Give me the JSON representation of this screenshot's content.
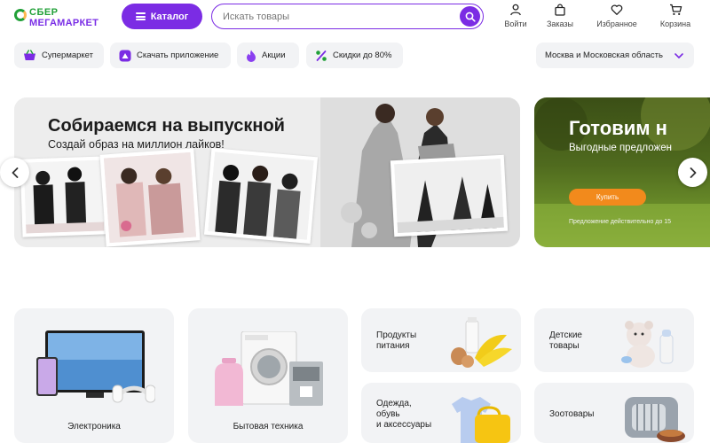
{
  "header": {
    "logo_line1": "СБЕР",
    "logo_line2": "МЕГАМАРКЕТ",
    "catalog_label": "Каталог",
    "search_placeholder": "Искать товары",
    "links": [
      {
        "label": "Войти",
        "icon": "user-icon"
      },
      {
        "label": "Заказы",
        "icon": "bag-icon"
      },
      {
        "label": "Избранное",
        "icon": "heart-icon"
      },
      {
        "label": "Корзина",
        "icon": "cart-icon"
      }
    ]
  },
  "chips": [
    {
      "label": "Супермаркет",
      "icon": "basket-icon"
    },
    {
      "label": "Скачать приложение",
      "icon": "app-icon"
    },
    {
      "label": "Акции",
      "icon": "fire-icon"
    },
    {
      "label": "Скидки до 80%",
      "icon": "percent-icon"
    }
  ],
  "region": {
    "label": "Москва и Московская область",
    "icon": "chevron-down-icon"
  },
  "banners": [
    {
      "title": "Собираемся на выпускной",
      "subtitle": "Создай образ на миллион лайков!"
    },
    {
      "title": "Готовим н",
      "subtitle": "Выгодные предложен",
      "button": "Купить",
      "note": "Предложение действительно до 15"
    }
  ],
  "categories": [
    {
      "label": "Электроника"
    },
    {
      "label": "Бытовая техника"
    },
    {
      "label": "Продукты\nпитания"
    },
    {
      "label": "Детские\nтовары"
    },
    {
      "label": "Одежда,\nобувь\nи аксессуары"
    },
    {
      "label": "Зоотовары"
    }
  ],
  "colors": {
    "brand_purple": "#7b2ce4",
    "brand_green": "#21a038",
    "accent_orange": "#f28a1c",
    "chip_bg": "#f2f3f5"
  }
}
